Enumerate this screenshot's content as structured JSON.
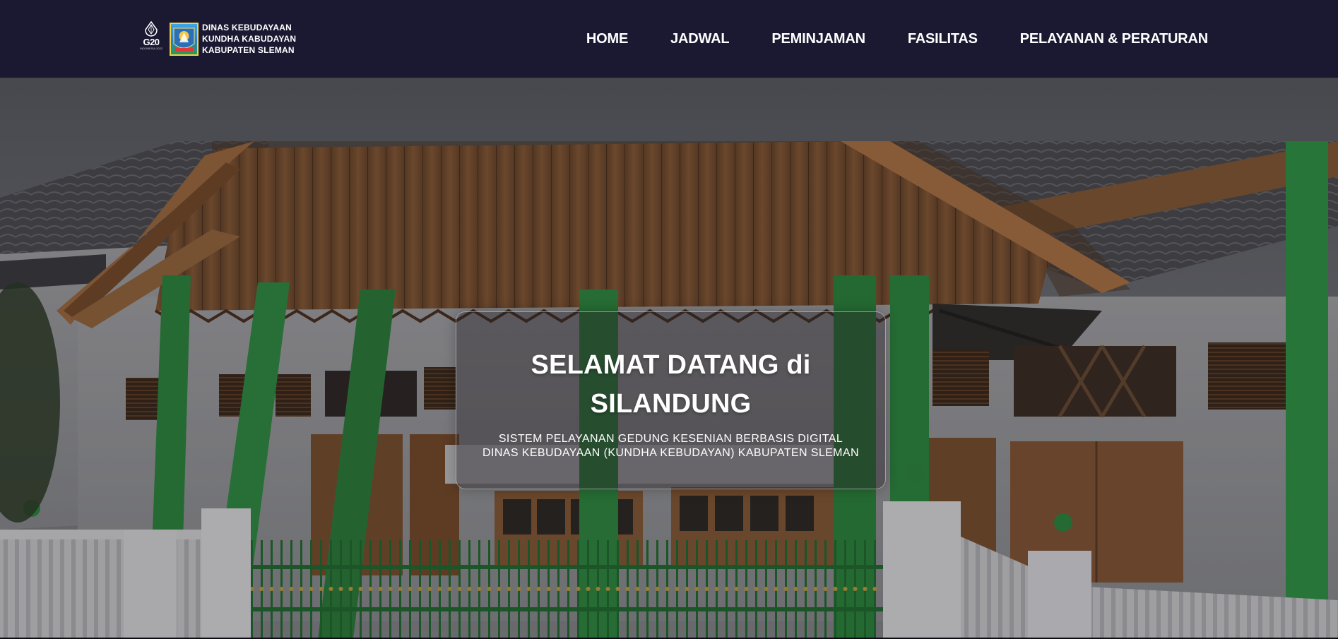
{
  "brand": {
    "g20_label": "G20",
    "g20_sub": "INDONESIA 2022",
    "line1": "DINAS KEBUDAYAAN",
    "line2": "KUNDHA KABUDAYAN",
    "line3": "KABUPATEN SLEMAN"
  },
  "nav": {
    "items": [
      {
        "label": "HOME"
      },
      {
        "label": "JADWAL"
      },
      {
        "label": "PEMINJAMAN"
      },
      {
        "label": "FASILITAS"
      },
      {
        "label": "PELAYANAN & PERATURAN"
      }
    ]
  },
  "hero": {
    "title_line1": "SELAMAT DATANG di",
    "title_line2": "SILANDUNG",
    "subtitle_line1": "SISTEM PELAYANAN GEDUNG KESENIAN BERBASIS DIGITAL",
    "subtitle_line2": "DINAS KEBUDAYAAN (KUNDHA KEBUDAYAN) KABUPATEN SLEMAN"
  },
  "colors": {
    "navbar_bg": "#1b1932",
    "text": "#ffffff",
    "pillar_green": "#2c8a3c",
    "wood": "#8a5a32"
  }
}
